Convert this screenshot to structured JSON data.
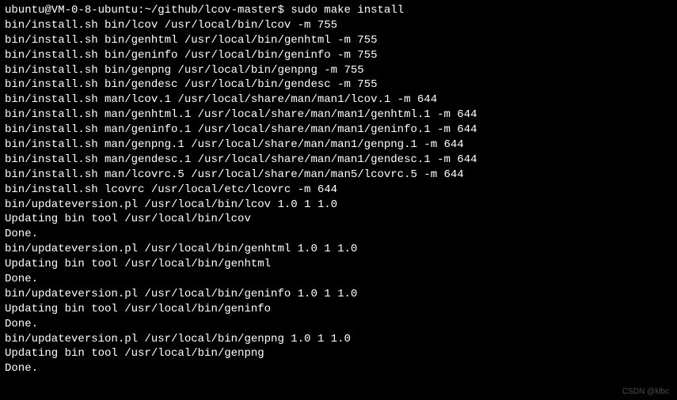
{
  "prompt": {
    "user_host": "ubuntu@VM-0-8-ubuntu",
    "separator": ":",
    "path": "~/github/lcov-master",
    "symbol": "$",
    "command": "sudo make install"
  },
  "output_lines": [
    "bin/install.sh bin/lcov /usr/local/bin/lcov -m 755",
    "bin/install.sh bin/genhtml /usr/local/bin/genhtml -m 755",
    "bin/install.sh bin/geninfo /usr/local/bin/geninfo -m 755",
    "bin/install.sh bin/genpng /usr/local/bin/genpng -m 755",
    "bin/install.sh bin/gendesc /usr/local/bin/gendesc -m 755",
    "bin/install.sh man/lcov.1 /usr/local/share/man/man1/lcov.1 -m 644",
    "bin/install.sh man/genhtml.1 /usr/local/share/man/man1/genhtml.1 -m 644",
    "bin/install.sh man/geninfo.1 /usr/local/share/man/man1/geninfo.1 -m 644",
    "bin/install.sh man/genpng.1 /usr/local/share/man/man1/genpng.1 -m 644",
    "bin/install.sh man/gendesc.1 /usr/local/share/man/man1/gendesc.1 -m 644",
    "bin/install.sh man/lcovrc.5 /usr/local/share/man/man5/lcovrc.5 -m 644",
    "bin/install.sh lcovrc /usr/local/etc/lcovrc -m 644",
    "bin/updateversion.pl /usr/local/bin/lcov 1.0 1 1.0",
    "Updating bin tool /usr/local/bin/lcov",
    "Done.",
    "bin/updateversion.pl /usr/local/bin/genhtml 1.0 1 1.0",
    "Updating bin tool /usr/local/bin/genhtml",
    "Done.",
    "bin/updateversion.pl /usr/local/bin/geninfo 1.0 1 1.0",
    "Updating bin tool /usr/local/bin/geninfo",
    "Done.",
    "bin/updateversion.pl /usr/local/bin/genpng 1.0 1 1.0",
    "Updating bin tool /usr/local/bin/genpng",
    "Done."
  ],
  "watermark": "CSDN @klbc"
}
